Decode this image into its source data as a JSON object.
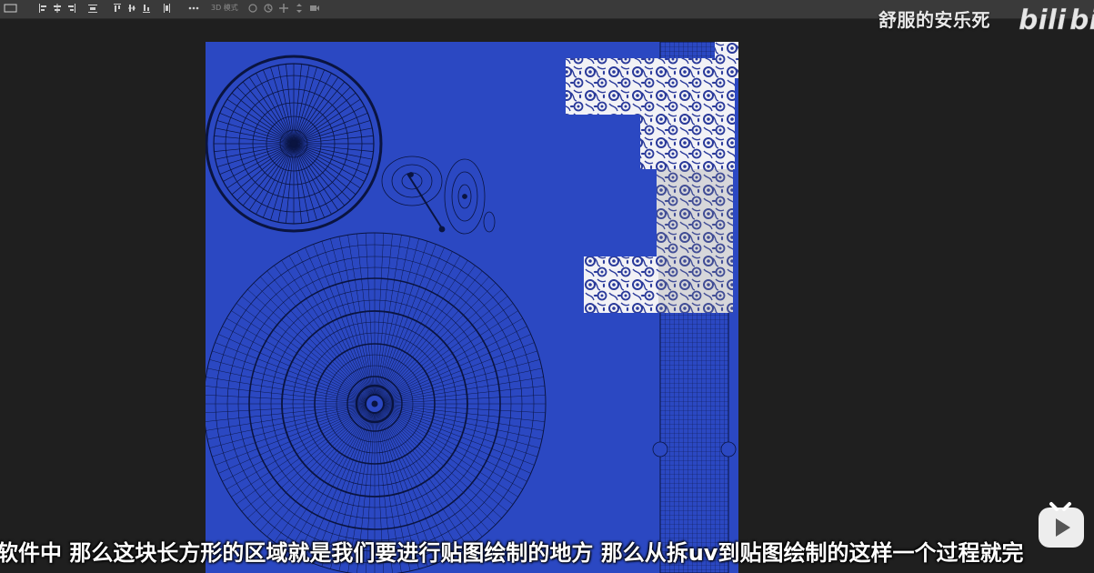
{
  "toolbar": {
    "items": [
      "align-left-icon",
      "align-center-icon",
      "align-right-icon",
      "distribute-icon",
      "align-top-icon",
      "align-middle-icon",
      "align-bottom-icon",
      "distribute-vertical-icon",
      "more-icon"
    ],
    "mode_label": "3D 模式",
    "mode_icons": [
      "orbit-icon",
      "roll-icon",
      "pan-icon",
      "slide-icon",
      "video-icon"
    ]
  },
  "watermark": {
    "text": "舒服的安乐死",
    "logo": "bilibili"
  },
  "subtitle": {
    "text": "软件中 那么这块长方形的区域就是我们要进行贴图绘制的地方 那么从拆uv到贴图绘制的这样一个过程就完"
  },
  "player": {
    "play_icon": "play-button-icon"
  },
  "colors": {
    "canvas_bg": "#2b48c2",
    "mesh_lines": "#0a1440",
    "pattern_bg": "#f2f2f6",
    "pattern_ink": "#2a3a9a"
  }
}
